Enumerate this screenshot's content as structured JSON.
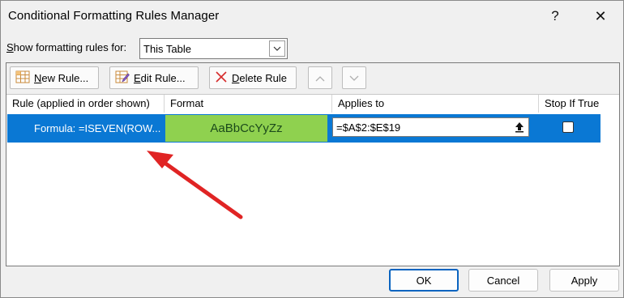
{
  "window": {
    "title": "Conditional Formatting Rules Manager",
    "help_glyph": "?",
    "close_glyph": "✕"
  },
  "scope": {
    "label_prefix": "S",
    "label_rest": "how formatting rules for:",
    "value": "This Table"
  },
  "toolbar": {
    "new_label_u": "N",
    "new_label_rest": "ew Rule...",
    "edit_label_u": "E",
    "edit_label_rest": "dit Rule...",
    "delete_label_u": "D",
    "delete_label_rest": "elete Rule"
  },
  "columns": {
    "rule": "Rule (applied in order shown)",
    "format": "Format",
    "applies": "Applies to",
    "stop": "Stop If True"
  },
  "rules": [
    {
      "formula": "Formula: =ISEVEN(ROW...",
      "preview": "AaBbCcYyZz",
      "applies_to": "=$A$2:$E$19",
      "stop_if_true": false
    }
  ],
  "footer": {
    "ok": "OK",
    "cancel": "Cancel",
    "apply": "Apply"
  },
  "colors": {
    "selection": "#0a78d4",
    "format_fill": "#8fd14f",
    "annotation_arrow": "#e02424"
  }
}
